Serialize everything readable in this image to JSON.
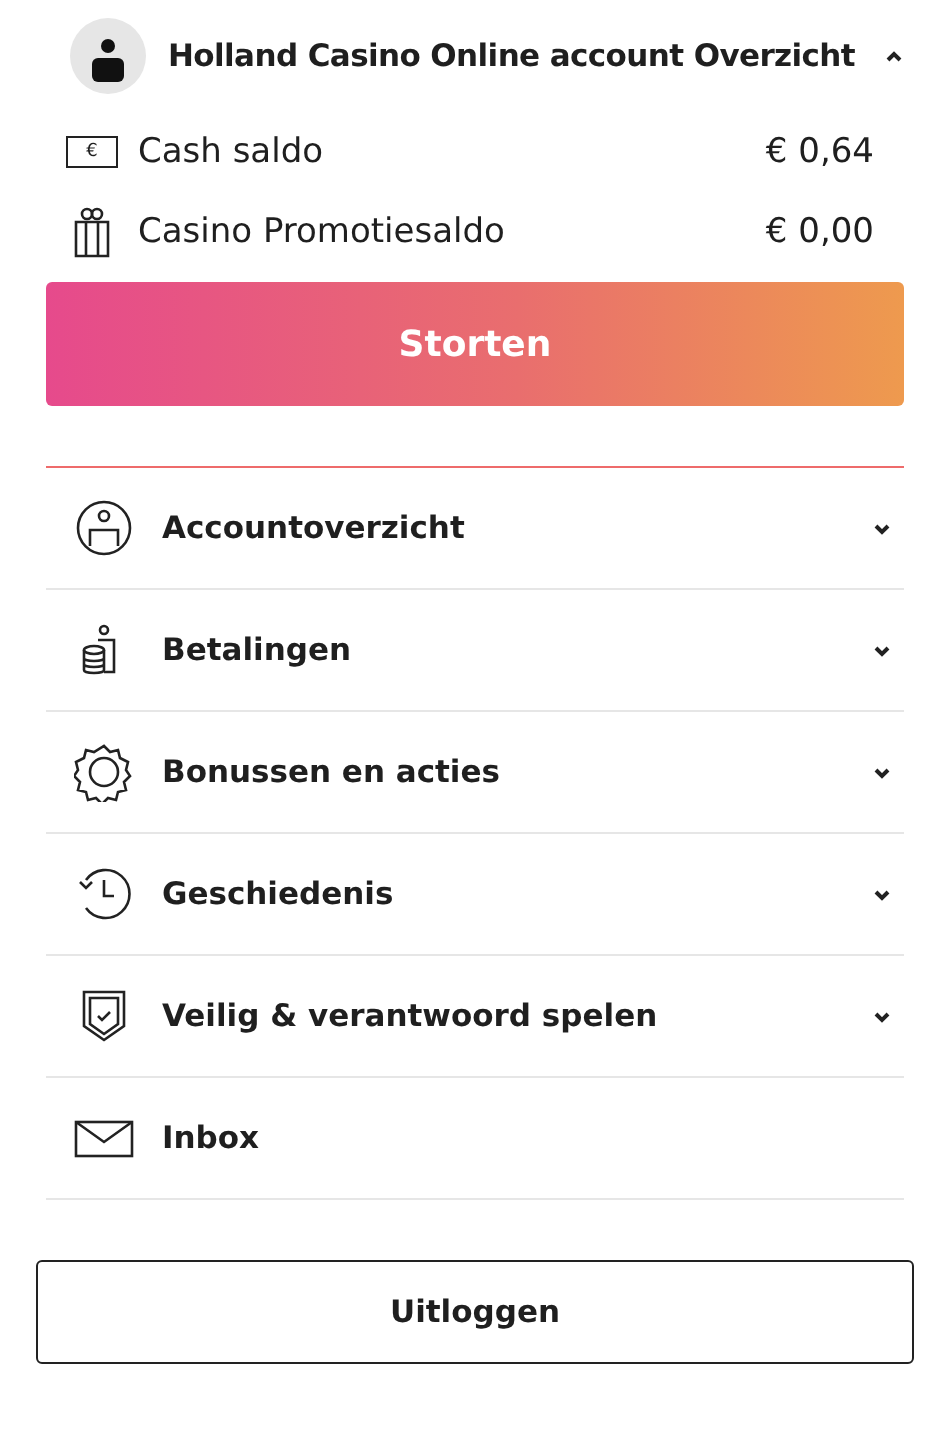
{
  "header": {
    "title": "Holland Casino Online account Overzicht",
    "expanded": true
  },
  "balances": [
    {
      "kind": "cash",
      "icon_text": "€",
      "label": "Cash saldo",
      "amount": "€ 0,64"
    },
    {
      "kind": "gift",
      "label": "Casino Promotiesaldo",
      "amount": "€ 0,00"
    }
  ],
  "deposit_button": "Storten",
  "menu": [
    {
      "kind": "account",
      "label": "Accountoverzicht",
      "expandable": true
    },
    {
      "kind": "payments",
      "label": "Betalingen",
      "expandable": true
    },
    {
      "kind": "bonus",
      "label": "Bonussen en acties",
      "expandable": true
    },
    {
      "kind": "history",
      "label": "Geschiedenis",
      "expandable": true
    },
    {
      "kind": "safety",
      "label": "Veilig & verantwoord spelen",
      "expandable": true
    },
    {
      "kind": "inbox",
      "label": "Inbox",
      "expandable": false
    }
  ],
  "logout_button": "Uitloggen"
}
